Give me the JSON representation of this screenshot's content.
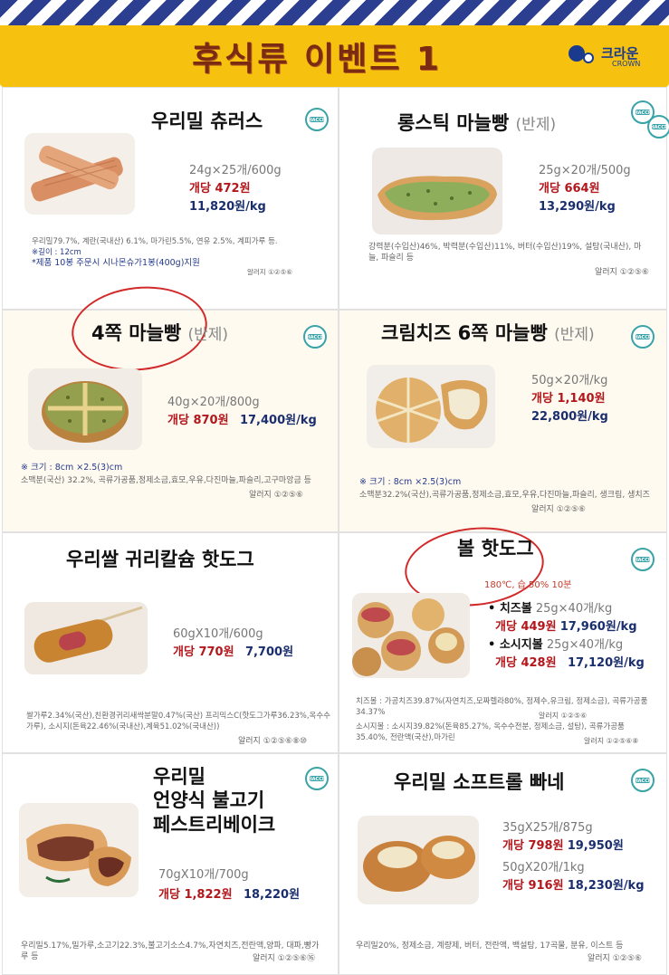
{
  "header": {
    "title": "후식류 이벤트 1",
    "logo_text": "크라운",
    "logo_sub": "CROWN"
  },
  "colors": {
    "price_red": "#b3161b",
    "price_navy": "#1a2e6e",
    "header_yellow": "#f7c20f",
    "title_brown": "#7a2b12"
  },
  "badge": "HACCP",
  "products": [
    {
      "title": "우리밀 츄러스",
      "spec": "24g×25개/600g",
      "unit_price": "개당 472원",
      "kg_price": "11,820원/kg",
      "ingredients": "우리밀79.7%, 계란(국내산) 6.1%, 마가린5.5%, 연유 2.5%, 계피가루 등.",
      "note1": "※길이 : 12cm",
      "note2": "*제품 10봉 주문시 시나몬슈가1봉(400g)지원",
      "allergy": "알러지 ①②⑤⑥"
    },
    {
      "title": "롱스틱 마늘빵",
      "title_suffix": "(반제)",
      "spec": "25g×20개/500g",
      "unit_price": "개당 664원",
      "kg_price": "13,290원/kg",
      "ingredients": "강력분(수입산)46%, 박력분(수입산)11%, 버터(수입산)19%, 설탕(국내산), 마늘, 파슬리 등",
      "allergy": "알러지 ①②⑤⑥"
    },
    {
      "title": "4쪽 마늘빵",
      "title_suffix": "(반제)",
      "spec": "40g×20개/800g",
      "unit_price": "개당 870원",
      "kg_price": "17,400원/kg",
      "size": "※ 크기 : 8cm ×2.5(3)cm",
      "ingredients": "소맥분(국산) 32.2%, 곡류가공품,정제소금,효모,우유,다진마늘,파슬리,고구마앙금 등",
      "allergy": "알러지 ①②⑤⑥"
    },
    {
      "title": "크림치즈 6쪽 마늘빵",
      "title_suffix": "(반제)",
      "spec": "50g×20개/kg",
      "unit_price": "개당 1,140원",
      "kg_price": "22,800원/kg",
      "size": "※ 크기 : 8cm ×2.5(3)cm",
      "ingredients": "소맥분32.2%(국산),곡류가공품,정제소금,효모,우유,다진마늘,파슬리, 생크림, 생치즈",
      "allergy": "알러지 ①②⑤⑥"
    },
    {
      "title": "우리쌀 귀리칼슘 핫도그",
      "spec": "60gX10개/600g",
      "unit_price": "개당 770원",
      "kg_price": "7,700원",
      "ingredients": "쌀가루2.34%(국산),친환경귀리새싹분말0.47%(국산) 프리믹스C(핫도그가루36.23%,옥수수가루), 소시지(돈육22.46%(국내산),계육51.02%(국내산))",
      "allergy": "알러지 ①②⑤⑥⑧⑩"
    },
    {
      "title": "볼 핫도그",
      "cook": "180℃, 습 50% 10분",
      "variants": [
        {
          "name": "• 치즈볼",
          "spec": "25g×40개/kg",
          "unit_price": "개당 449원",
          "kg_price": "17,960원/kg"
        },
        {
          "name": "• 소시지볼",
          "spec": "25g×40개/kg",
          "unit_price": "개당 428원",
          "kg_price": "17,120원/kg"
        }
      ],
      "ingredients1": "치즈볼 : 가공치즈39.87%(자연치즈,모짜렐라80%, 정제수,유크림, 정제소금), 곡류가공품34.37%",
      "allergy1": "알러지 ①②⑤⑥",
      "ingredients2": "소시지볼 : 소시지39.82%(돈육85.27%, 옥수수전분, 정제소금, 설탕), 곡류가공품35.40%, 전란액(국산),마가린",
      "allergy2": "알러지 ①②⑤⑥⑧"
    },
    {
      "title_lines": [
        "우리밀",
        "언양식 불고기",
        "페스트리베이크"
      ],
      "spec": "70gX10개/700g",
      "unit_price": "개당 1,822원",
      "kg_price": "18,220원",
      "ingredients": "우리밀5.17%,밀가루,소고기22.3%,불고기소스4.7%,자연치즈,전란액,양파, 대파,빵가루 등",
      "allergy": "알러지 ①②⑤⑥⑯"
    },
    {
      "title": "우리밀 소프트롤 빠네",
      "variants": [
        {
          "spec": "35gX25개/875g",
          "unit_price": "개당 798원",
          "kg_price": "19,950원"
        },
        {
          "spec": "50gX20개/1kg",
          "unit_price": "개당 916원",
          "kg_price": "18,230원/kg"
        }
      ],
      "ingredients": "우리밀20%, 정제소금, 계량제, 버터, 전란액, 백설탕, 17곡물, 분유, 이스트 등",
      "allergy": "알러지 ①②⑤⑥"
    }
  ]
}
